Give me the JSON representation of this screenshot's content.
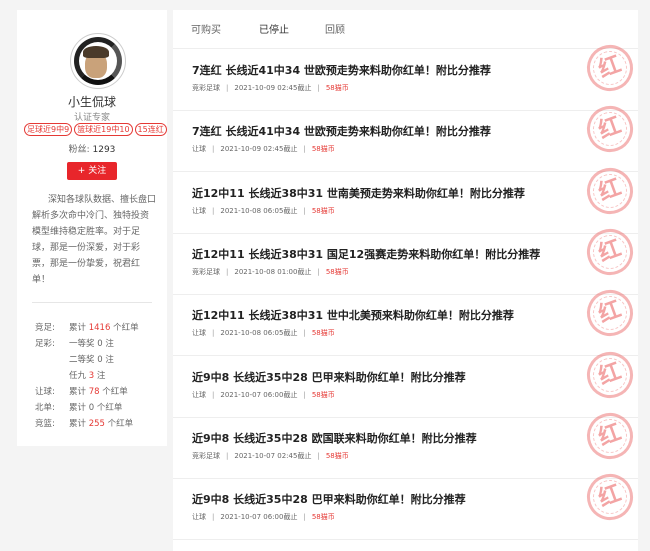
{
  "profile": {
    "name": "小生侃球",
    "certification": "认证专家",
    "badges": [
      "足球近9中9",
      "篮球近19中10",
      "15连红"
    ],
    "fans_label": "粉丝:",
    "fans_count": "1293",
    "follow_label": "+ 关注",
    "description": "深知各球队数据、擅长盘口解析多次命中冷门、独特投资模型维持稳定胜率。对于足球，那是一份深爱，对于彩票，那是一份挚爱，祝君红单！"
  },
  "stats": [
    {
      "label": "竞足:",
      "prefix": "累计",
      "value": "1416",
      "suffix": "个红单",
      "value_red": true
    },
    {
      "label": "足彩:",
      "prefix": "一等奖",
      "value": "0",
      "suffix": "注",
      "value_red": false
    },
    {
      "label": "",
      "prefix": "二等奖",
      "value": "0",
      "suffix": "注",
      "value_red": false
    },
    {
      "label": "",
      "prefix": "任九",
      "value": "3",
      "suffix": "注",
      "value_red": true
    },
    {
      "label": "让球:",
      "prefix": "累计",
      "value": "78",
      "suffix": "个红单",
      "value_red": true
    },
    {
      "label": "北单:",
      "prefix": "累计",
      "value": "0",
      "suffix": "个红单",
      "value_red": false
    },
    {
      "label": "竞篮:",
      "prefix": "累计",
      "value": "255",
      "suffix": "个红单",
      "value_red": true
    }
  ],
  "tabs": [
    "可购买",
    "已停止",
    "回顾"
  ],
  "active_tab": 1,
  "stamp_text": "红",
  "items": [
    {
      "title": "7连红 长线近41中34 世欧预走势来料助你红单！附比分推荐",
      "category": "竞彩足球",
      "time": "2021-10-09 02:45截止",
      "price": "58猫币"
    },
    {
      "title": "7连红 长线近41中34 世欧预走势来料助你红单！附比分推荐",
      "category": "让球",
      "time": "2021-10-09 02:45截止",
      "price": "58猫币"
    },
    {
      "title": "近12中11 长线近38中31 世南美预走势来料助你红单！附比分推荐",
      "category": "让球",
      "time": "2021-10-08 06:05截止",
      "price": "58猫币"
    },
    {
      "title": "近12中11 长线近38中31 国足12强赛走势来料助你红单！附比分推荐",
      "category": "竞彩足球",
      "time": "2021-10-08 01:00截止",
      "price": "58猫币"
    },
    {
      "title": "近12中11 长线近38中31 世中北美预来料助你红单！附比分推荐",
      "category": "让球",
      "time": "2021-10-08 06:05截止",
      "price": "58猫币"
    },
    {
      "title": "近9中8 长线近35中28 巴甲来料助你红单！附比分推荐",
      "category": "让球",
      "time": "2021-10-07 06:00截止",
      "price": "58猫币"
    },
    {
      "title": "近9中8 长线近35中28 欧国联来料助你红单！附比分推荐",
      "category": "竞彩足球",
      "time": "2021-10-07 02:45截止",
      "price": "58猫币"
    },
    {
      "title": "近9中8 长线近35中28 巴甲来料助你红单！附比分推荐",
      "category": "让球",
      "time": "2021-10-07 06:00截止",
      "price": "58猫币"
    }
  ]
}
